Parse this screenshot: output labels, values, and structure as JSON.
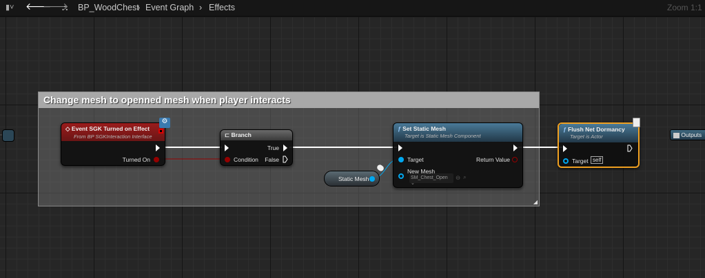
{
  "toolbar": {
    "bookmark_icon": "bookmark-icon",
    "back_icon": "arrow-left-icon",
    "forward_icon": "arrow-right-icon",
    "graph_icon": "hierarchy-icon",
    "breadcrumbs": [
      "BP_WoodChest",
      "Event Graph",
      "Effects"
    ],
    "zoom": "Zoom 1:1"
  },
  "comment": {
    "text": "Change mesh to openned mesh when player interacts",
    "color": "#a8a8a8"
  },
  "nodes": {
    "event": {
      "title": "Event SGK Turned on Effect",
      "subtitle": "From BP SGKInteraction Interface",
      "out_pin": "Turned On",
      "color": "#8b1a1a"
    },
    "branch": {
      "title": "Branch",
      "in_pin": "Condition",
      "true_pin": "True",
      "false_pin": "False"
    },
    "set_mesh": {
      "title": "Set Static Mesh",
      "subtitle": "Target is Static Mesh Component",
      "target_pin": "Target",
      "new_mesh_pin": "New Mesh",
      "mesh_value": "SM_Chest_Open",
      "return_pin": "Return Value"
    },
    "variable": {
      "label": "Static Mesh"
    },
    "flush": {
      "title": "Flush Net Dormancy",
      "subtitle": "Target is Actor",
      "target_pin": "Target",
      "target_value": "self",
      "border_color": "#f0a020"
    },
    "outputs": {
      "label": "Outputs"
    }
  },
  "colors": {
    "exec": "#ffffff",
    "bool": "#950000",
    "object": "#00a8f0"
  }
}
